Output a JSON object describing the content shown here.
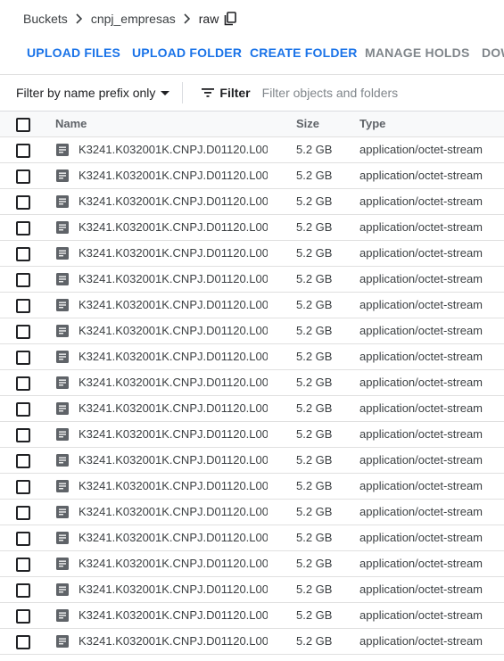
{
  "breadcrumb": {
    "items": [
      "Buckets",
      "cnpj_empresas"
    ],
    "current": "raw"
  },
  "toolbar": {
    "upload_files": "UPLOAD FILES",
    "upload_folder": "UPLOAD FOLDER",
    "create_folder": "CREATE FOLDER",
    "manage_holds": "MANAGE HOLDS",
    "download": "DOW"
  },
  "filter": {
    "mode": "Filter by name prefix only",
    "label": "Filter",
    "placeholder": "Filter objects and folders"
  },
  "table": {
    "columns": {
      "name": "Name",
      "size": "Size",
      "type": "Type"
    },
    "rows": [
      {
        "name": "K3241.K032001K.CNPJ.D01120.L00",
        "size": "5.2 GB",
        "type": "application/octet-stream"
      },
      {
        "name": "K3241.K032001K.CNPJ.D01120.L00",
        "size": "5.2 GB",
        "type": "application/octet-stream"
      },
      {
        "name": "K3241.K032001K.CNPJ.D01120.L00",
        "size": "5.2 GB",
        "type": "application/octet-stream"
      },
      {
        "name": "K3241.K032001K.CNPJ.D01120.L00",
        "size": "5.2 GB",
        "type": "application/octet-stream"
      },
      {
        "name": "K3241.K032001K.CNPJ.D01120.L00",
        "size": "5.2 GB",
        "type": "application/octet-stream"
      },
      {
        "name": "K3241.K032001K.CNPJ.D01120.L00",
        "size": "5.2 GB",
        "type": "application/octet-stream"
      },
      {
        "name": "K3241.K032001K.CNPJ.D01120.L00",
        "size": "5.2 GB",
        "type": "application/octet-stream"
      },
      {
        "name": "K3241.K032001K.CNPJ.D01120.L00",
        "size": "5.2 GB",
        "type": "application/octet-stream"
      },
      {
        "name": "K3241.K032001K.CNPJ.D01120.L00",
        "size": "5.2 GB",
        "type": "application/octet-stream"
      },
      {
        "name": "K3241.K032001K.CNPJ.D01120.L00",
        "size": "5.2 GB",
        "type": "application/octet-stream"
      },
      {
        "name": "K3241.K032001K.CNPJ.D01120.L00",
        "size": "5.2 GB",
        "type": "application/octet-stream"
      },
      {
        "name": "K3241.K032001K.CNPJ.D01120.L00",
        "size": "5.2 GB",
        "type": "application/octet-stream"
      },
      {
        "name": "K3241.K032001K.CNPJ.D01120.L00",
        "size": "5.2 GB",
        "type": "application/octet-stream"
      },
      {
        "name": "K3241.K032001K.CNPJ.D01120.L00",
        "size": "5.2 GB",
        "type": "application/octet-stream"
      },
      {
        "name": "K3241.K032001K.CNPJ.D01120.L00",
        "size": "5.2 GB",
        "type": "application/octet-stream"
      },
      {
        "name": "K3241.K032001K.CNPJ.D01120.L00",
        "size": "5.2 GB",
        "type": "application/octet-stream"
      },
      {
        "name": "K3241.K032001K.CNPJ.D01120.L00",
        "size": "5.2 GB",
        "type": "application/octet-stream"
      },
      {
        "name": "K3241.K032001K.CNPJ.D01120.L00",
        "size": "5.2 GB",
        "type": "application/octet-stream"
      },
      {
        "name": "K3241.K032001K.CNPJ.D01120.L00",
        "size": "5.2 GB",
        "type": "application/octet-stream"
      },
      {
        "name": "K3241.K032001K.CNPJ.D01120.L00",
        "size": "5.2 GB",
        "type": "application/octet-stream"
      }
    ]
  },
  "icons": {
    "breadcrumb_separator": "chevron-right-icon",
    "copy": "copy-icon",
    "filter": "filter-list-icon",
    "file": "file-icon",
    "dropdown": "caret-down-icon"
  },
  "colors": {
    "accent": "#1a73e8",
    "disabled": "#80868b",
    "header_bg": "#f8f9fa",
    "divider": "#e0e0e0"
  }
}
